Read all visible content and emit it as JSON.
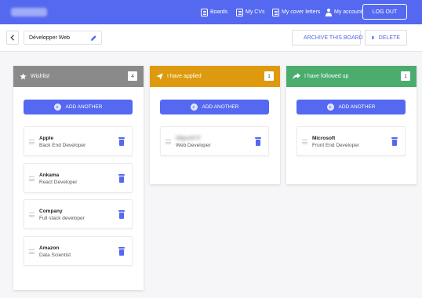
{
  "header": {
    "nav": [
      {
        "label": "Boards",
        "icon": "boards-icon"
      },
      {
        "label": "My CVs",
        "icon": "cv-icon"
      },
      {
        "label": "My cover letters",
        "icon": "cover-letter-icon"
      },
      {
        "label": "My account",
        "icon": "user-icon"
      }
    ],
    "logout_label": "LOG OUT"
  },
  "toolbar": {
    "board_name": "Développer Web",
    "archive_label": "ARCHIVE THIS BOARD",
    "delete_label": "DELETE"
  },
  "colors": {
    "accent": "#5468f0",
    "wishlist": "#8a8a8a",
    "applied": "#de9a0e",
    "followed_up": "#4aad6e"
  },
  "columns": [
    {
      "title": "Wishlist",
      "count": "4",
      "icon": "star-icon",
      "add_label": "ADD ANOTHER",
      "cards": [
        {
          "company": "Apple",
          "role": "Back End Developer"
        },
        {
          "company": "Ankama",
          "role": "React Developer"
        },
        {
          "company": "Company",
          "role": "Full stack developer"
        },
        {
          "company": "Amazon",
          "role": "Data Scientist"
        }
      ]
    },
    {
      "title": "I have applied",
      "count": "1",
      "icon": "paper-plane-icon",
      "add_label": "ADD ANOTHER",
      "cards": [
        {
          "company": "Objectif IT",
          "role": "Web Developer"
        }
      ]
    },
    {
      "title": "I have followed up",
      "count": "1",
      "icon": "share-arrow-icon",
      "add_label": "ADD ANOTHER",
      "cards": [
        {
          "company": "Microsoft",
          "role": "Front End Developer"
        }
      ]
    }
  ]
}
